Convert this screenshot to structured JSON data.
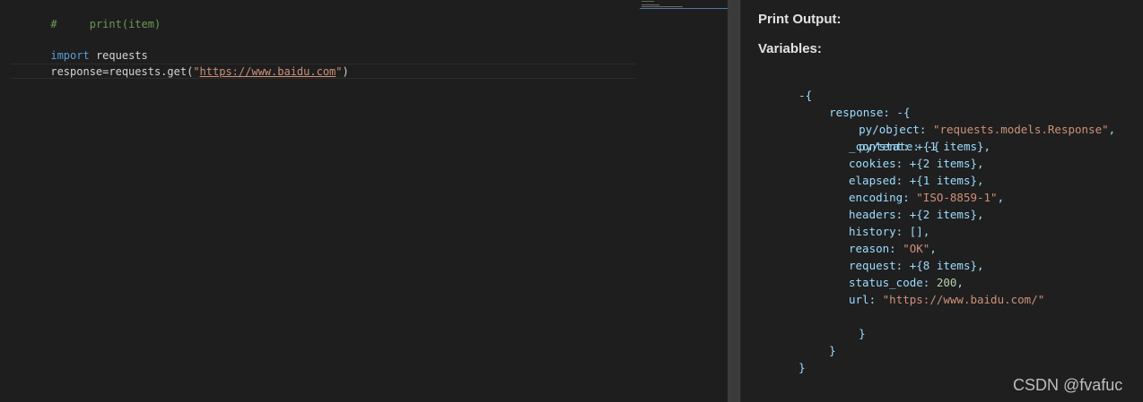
{
  "editor": {
    "lines": [
      {
        "comment_marker": "#",
        "comment_text": "print(item)"
      },
      {
        "keyword": "import",
        "module": "requests"
      },
      {
        "assign": "response=requests.get(",
        "quote_open": "\"",
        "url": "https://www.baidu.com",
        "quote_close": "\"",
        "close_paren": ")"
      }
    ]
  },
  "output": {
    "print_heading": "Print Output:",
    "variables_heading": "Variables:",
    "tree": {
      "root_open": "-{",
      "response_key": "response:",
      "response_open": "-{",
      "py_object_key": "py/object:",
      "py_object_value": "\"requests.models.Response\"",
      "py_state_key": "py/state:",
      "py_state_open": "-{",
      "items": [
        {
          "key": "_content:",
          "value": "+{1 items}",
          "kind": "collapsed"
        },
        {
          "key": "cookies:",
          "value": "+{2 items}",
          "kind": "collapsed"
        },
        {
          "key": "elapsed:",
          "value": "+{1 items}",
          "kind": "collapsed"
        },
        {
          "key": "encoding:",
          "value": "\"ISO-8859-1\"",
          "kind": "string"
        },
        {
          "key": "headers:",
          "value": "+{2 items}",
          "kind": "collapsed"
        },
        {
          "key": "history:",
          "value": "[]",
          "kind": "plain"
        },
        {
          "key": "reason:",
          "value": "\"OK\"",
          "kind": "string"
        },
        {
          "key": "request:",
          "value": "+{8 items}",
          "kind": "collapsed"
        },
        {
          "key": "status_code:",
          "value": "200",
          "kind": "number"
        },
        {
          "key": "url:",
          "value": "\"https://www.baidu.com/\"",
          "kind": "string"
        }
      ],
      "close_brace": "}"
    }
  },
  "watermark": "CSDN @fvafuc",
  "colors": {
    "background": "#1e1e1e",
    "comment": "#6a9955",
    "keyword": "#569cd6",
    "string": "#ce9178",
    "json_key": "#9cdcfe",
    "number": "#b5cea8"
  }
}
